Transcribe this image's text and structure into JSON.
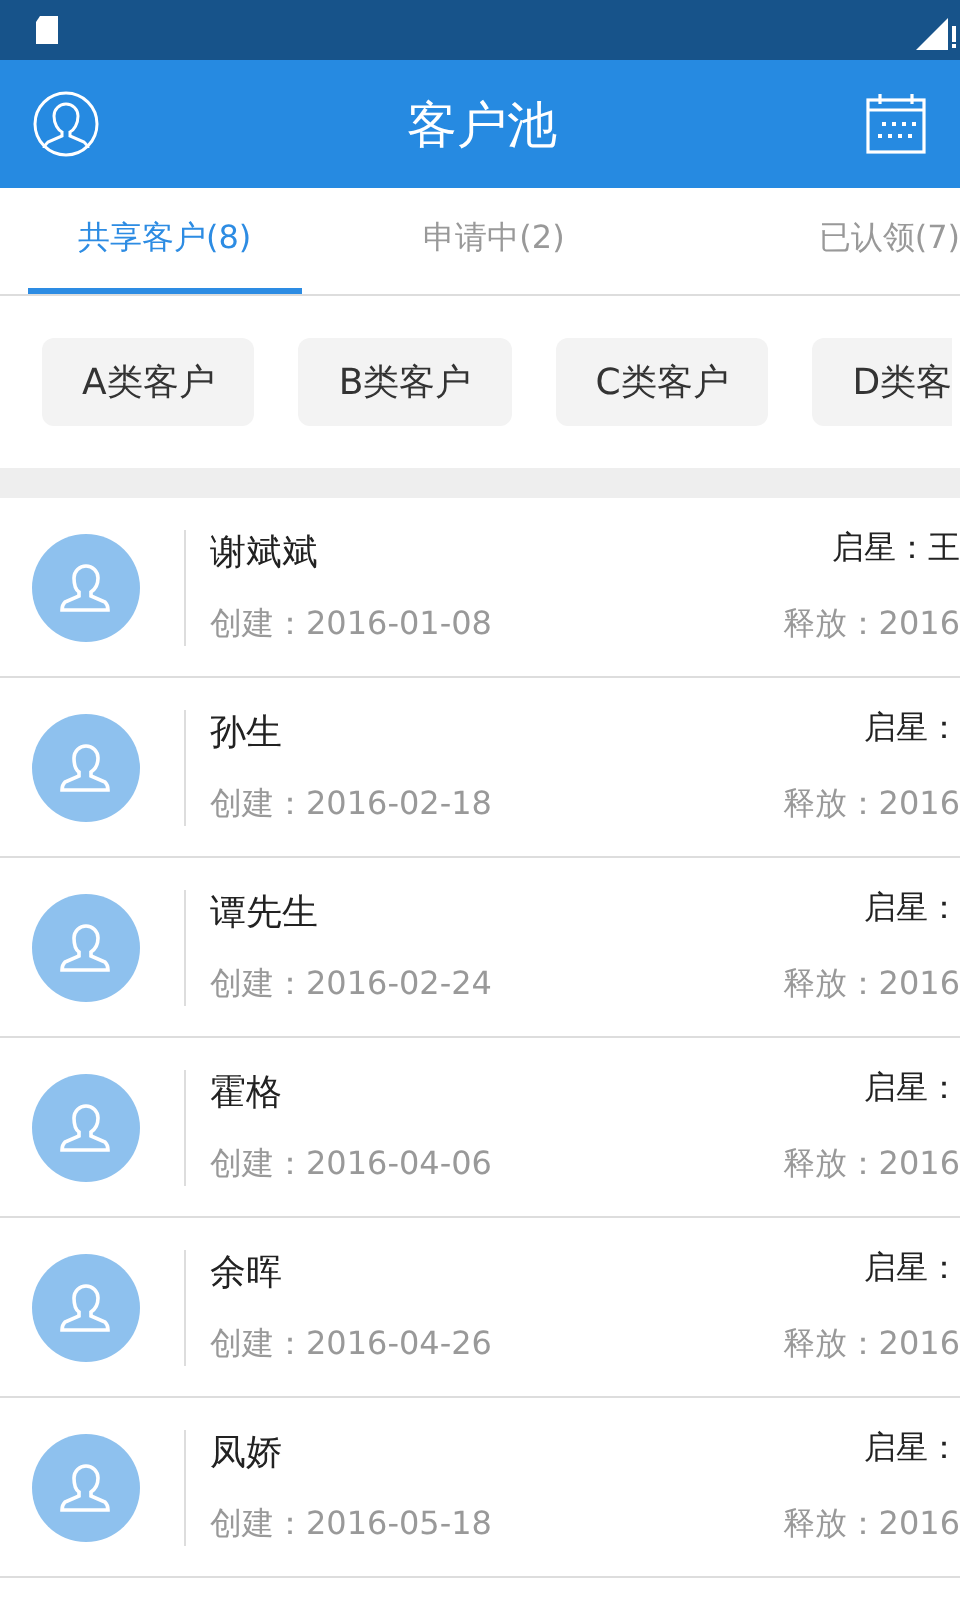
{
  "header": {
    "title": "客户池"
  },
  "tabs": [
    {
      "label": "共享客户(8)",
      "selected": true
    },
    {
      "label": "申请中(2)",
      "selected": false
    },
    {
      "label": "已认领(7)",
      "selected": false
    }
  ],
  "categories": [
    "A类客户",
    "B类客户",
    "C类客户",
    "D类客"
  ],
  "customers": [
    {
      "name": "谢斌斌",
      "created": "创建：2016-01-08",
      "owner": "启星：王",
      "released": "释放：2016"
    },
    {
      "name": "孙生",
      "created": "创建：2016-02-18",
      "owner": "启星：",
      "released": "释放：2016"
    },
    {
      "name": "谭先生",
      "created": "创建：2016-02-24",
      "owner": "启星：",
      "released": "释放：2016"
    },
    {
      "name": "霍格",
      "created": "创建：2016-04-06",
      "owner": "启星：",
      "released": "释放：2016"
    },
    {
      "name": "余晖",
      "created": "创建：2016-04-26",
      "owner": "启星：",
      "released": "释放：2016"
    },
    {
      "name": "凤娇",
      "created": "创建：2016-05-18",
      "owner": "启星：",
      "released": "释放：2016"
    }
  ]
}
